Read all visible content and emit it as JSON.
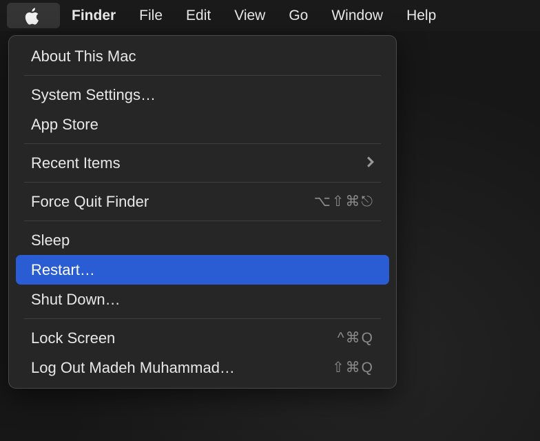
{
  "menubar": {
    "app_name": "Finder",
    "items": [
      "File",
      "Edit",
      "View",
      "Go",
      "Window",
      "Help"
    ]
  },
  "apple_menu": {
    "groups": [
      [
        {
          "label": "About This Mac"
        }
      ],
      [
        {
          "label": "System Settings…"
        },
        {
          "label": "App Store"
        }
      ],
      [
        {
          "label": "Recent Items",
          "accessory": "chevron"
        }
      ],
      [
        {
          "label": "Force Quit Finder",
          "shortcut": "⌥⇧⌘⎋"
        }
      ],
      [
        {
          "label": "Sleep"
        },
        {
          "label": "Restart…",
          "highlighted": true
        },
        {
          "label": "Shut Down…"
        }
      ],
      [
        {
          "label": "Lock Screen",
          "shortcut": "^⌘Q"
        },
        {
          "label": "Log Out Madeh Muhammad…",
          "shortcut": "⇧⌘Q"
        }
      ]
    ]
  }
}
